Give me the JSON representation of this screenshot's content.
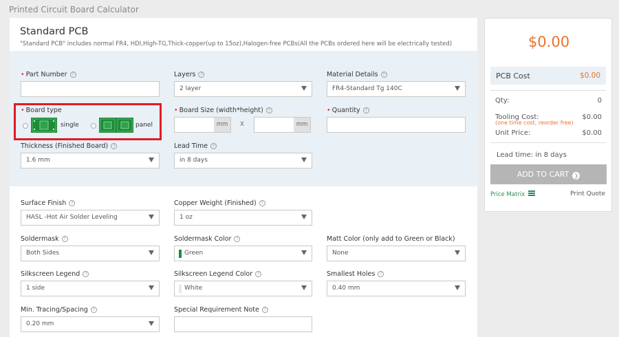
{
  "page_title": "Printed Circuit Board Calculator",
  "header": {
    "title": "Standard PCB",
    "subtitle": "\"Standard PCB\" includes normal FR4, HDI,High-TG,Thick-copper(up to 15oz),Halogen-free PCBs(All the PCBs ordered here will be electrically tested)"
  },
  "help_glyph": "?",
  "fields": {
    "part_number": {
      "label": "Part Number",
      "value": ""
    },
    "layers": {
      "label": "Layers",
      "value": "2 layer"
    },
    "material": {
      "label": "Material Details",
      "value": "FR4-Standard Tg 140C"
    },
    "board_type": {
      "label": "Board type",
      "option1": "single",
      "option2": "panel"
    },
    "board_size": {
      "label": "Board Size (width*height)",
      "unit": "mm",
      "separator": "X"
    },
    "quantity": {
      "label": "Quantity",
      "value": ""
    },
    "thickness": {
      "label": "Thickness (Finished Board)",
      "value": "1.6 mm"
    },
    "lead_time": {
      "label": "Lead Time",
      "value": "in 8 days"
    },
    "surface_finish": {
      "label": "Surface Finish",
      "value": "HASL -Hot Air Solder Leveling"
    },
    "copper_weight": {
      "label": "Copper Weight (Finished)",
      "value": "1 oz"
    },
    "soldermask": {
      "label": "Soldermask",
      "value": "Both Sides"
    },
    "soldermask_color": {
      "label": "Soldermask Color",
      "value": "Green",
      "swatch": "#1e8a3a"
    },
    "matt_color": {
      "label": "Matt Color (only add to Green or Black)",
      "value": "None"
    },
    "silkscreen_legend": {
      "label": "Silkscreen Legend",
      "value": "1 side"
    },
    "silkscreen_color": {
      "label": "Silkscreen Legend Color",
      "value": "White",
      "swatch": "#e8e8e8"
    },
    "smallest_holes": {
      "label": "Smallest Holes",
      "value": "0.40 mm"
    },
    "min_tracing": {
      "label": "Min. Tracing/Spacing",
      "value": "0.20 mm"
    },
    "special_note": {
      "label": "Special Requirement Note",
      "value": ""
    }
  },
  "summary": {
    "total": "$0.00",
    "pcb_cost_label": "PCB Cost",
    "pcb_cost_value": "$0.00",
    "qty_label": "Qty:",
    "qty_value": "0",
    "tooling_label": "Tooling Cost:",
    "tooling_note": "(one time cost, reorder free)",
    "tooling_value": "$0.00",
    "unit_price_label": "Unit Price:",
    "unit_price_value": "$0.00",
    "lead_time": "Lead time: in 8 days",
    "add_to_cart": "ADD TO CART",
    "price_matrix": "Price Matrix",
    "print_quote": "Print Quote"
  },
  "colors": {
    "accent": "#e8732e",
    "required": "#e33",
    "highlight_box": "#e01b24",
    "link": "#2a8a57",
    "pcb_green": "#1e8a3a"
  },
  "icons": {
    "help": "question-circle-icon",
    "caret": "caret-down-icon",
    "cart_arrow": "chevron-right-circle-icon",
    "matrix": "list-icon"
  }
}
